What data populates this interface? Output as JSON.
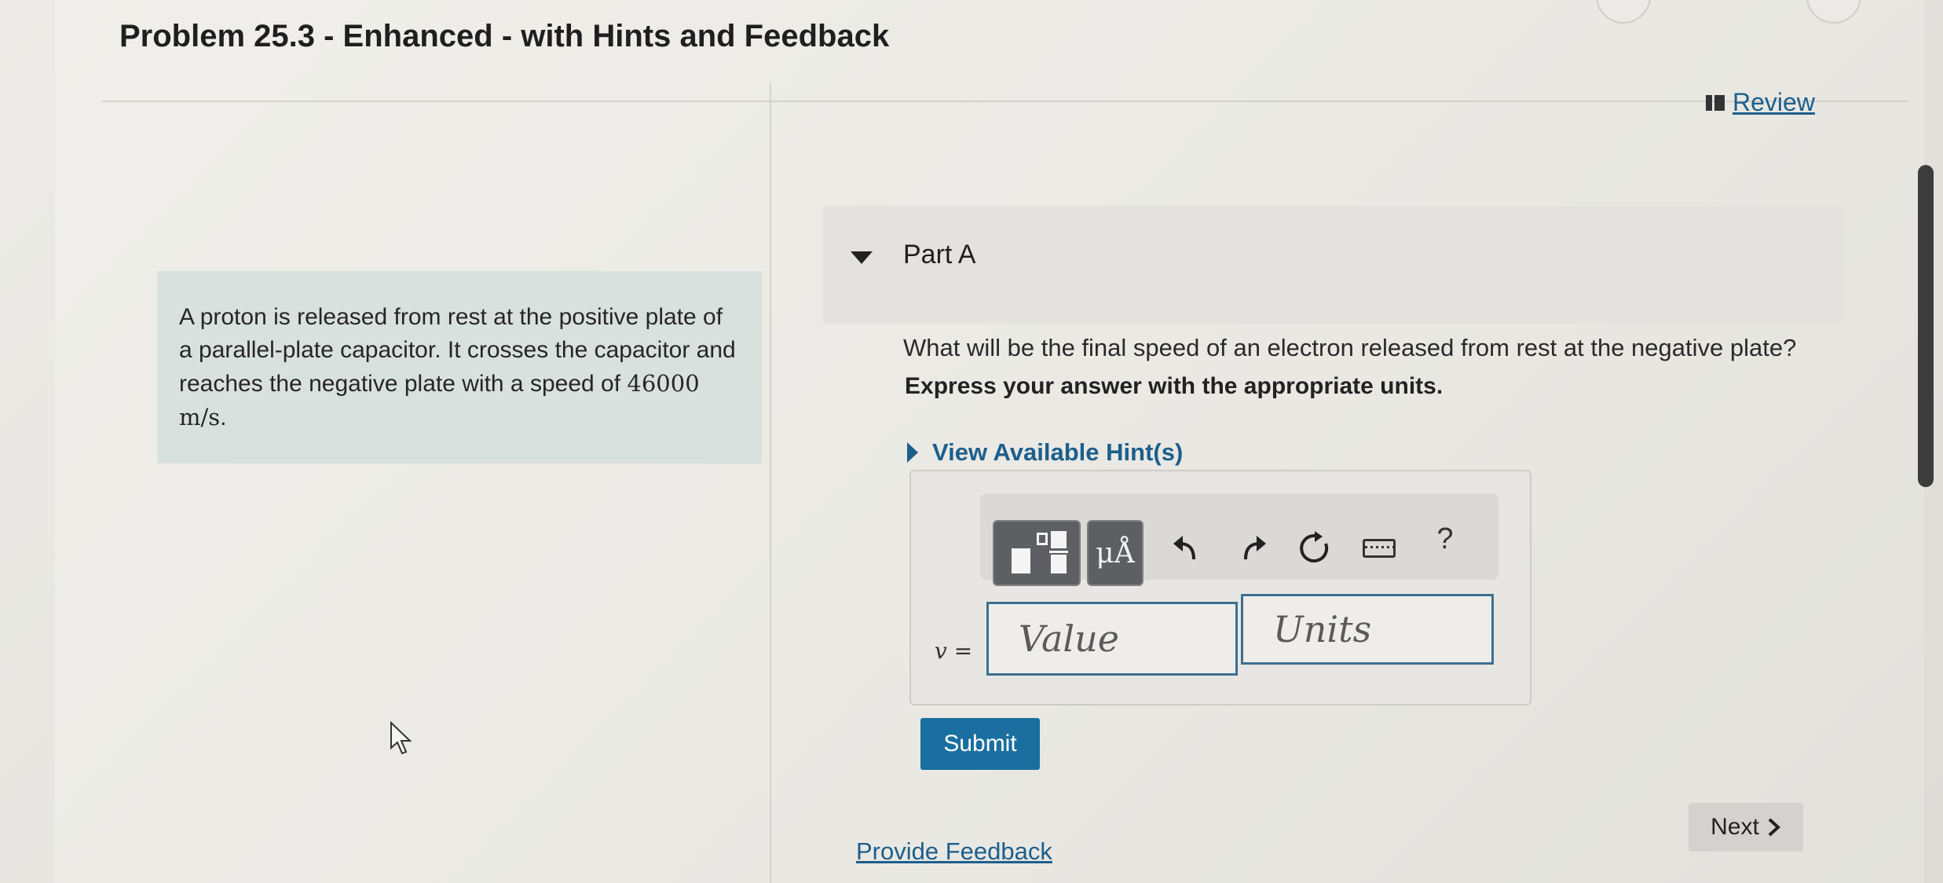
{
  "problem": {
    "title": "Problem 25.3 - Enhanced - with Hints and Feedback"
  },
  "header": {
    "review_label": "Review"
  },
  "intro": {
    "text_before": "A proton is released from rest at the positive plate of a parallel-plate capacitor. It crosses the capacitor and reaches the negative plate with a speed of",
    "speed_value": "46000",
    "speed_unit": "m/s",
    "text_after": "."
  },
  "part": {
    "title": "Part A",
    "question": "What will be the final speed of an electron released from rest at the negative plate?",
    "instruction": "Express your answer with the appropriate units.",
    "hints_label": "View Available Hint(s)"
  },
  "toolbar": {
    "units_button_label": "μÅ",
    "help_label": "?"
  },
  "answer": {
    "variable_label": "v =",
    "value_placeholder": "Value",
    "units_placeholder": "Units"
  },
  "actions": {
    "submit_label": "Submit",
    "feedback_label": "Provide Feedback",
    "next_label": "Next"
  },
  "colors": {
    "link": "#1d5f8c",
    "submit_bg": "#1a6fa0",
    "intro_bg": "#d9e1de",
    "toolbar_button": "#5d5f63"
  }
}
